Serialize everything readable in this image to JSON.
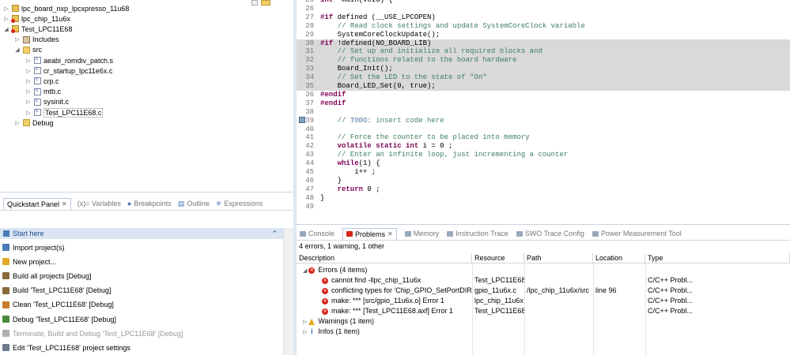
{
  "project_tree": {
    "items": [
      {
        "label": "lpc_board_nxp_lpcxpresso_11u68",
        "depth": 0,
        "twisty": "▷",
        "icon": "project-icon"
      },
      {
        "label": "lpc_chip_11u6x",
        "depth": 0,
        "twisty": "▷",
        "icon": "project-error-icon"
      },
      {
        "label": "Test_LPC11E68",
        "depth": 0,
        "twisty": "◢",
        "icon": "project-error-icon"
      },
      {
        "label": "Includes",
        "depth": 1,
        "twisty": "▷",
        "icon": "includes-icon"
      },
      {
        "label": "src",
        "depth": 1,
        "twisty": "◢",
        "icon": "folder-icon"
      },
      {
        "label": "aeabi_romdiv_patch.s",
        "depth": 2,
        "twisty": "▷",
        "icon": "file-icon"
      },
      {
        "label": "cr_startup_lpc11e6x.c",
        "depth": 2,
        "twisty": "▷",
        "icon": "file-icon"
      },
      {
        "label": "crp.c",
        "depth": 2,
        "twisty": "▷",
        "icon": "file-icon"
      },
      {
        "label": "mtb.c",
        "depth": 2,
        "twisty": "▷",
        "icon": "file-icon"
      },
      {
        "label": "sysinit.c",
        "depth": 2,
        "twisty": "▷",
        "icon": "file-icon"
      },
      {
        "label": "Test_LPC11E68.c",
        "depth": 2,
        "twisty": "▷",
        "icon": "file-icon"
      },
      {
        "label": "Debug",
        "depth": 1,
        "twisty": "▷",
        "icon": "folder-icon"
      }
    ]
  },
  "left_tabs": {
    "active": "Quickstart Panel",
    "others": [
      "(x)= Variables",
      "Breakpoints",
      "Outline",
      "Expressions"
    ]
  },
  "quickstart": {
    "header": "Start here",
    "items": [
      {
        "label": "Import project(s)",
        "color": "#4a7ab8",
        "enabled": true
      },
      {
        "label": "New project...",
        "color": "#e0a92a",
        "enabled": true
      },
      {
        "label": "Build all projects [Debug]",
        "color": "#8a6a3a",
        "enabled": true
      },
      {
        "label": "Build 'Test_LPC11E68' [Debug]",
        "color": "#8a6a3a",
        "enabled": true
      },
      {
        "label": "Clean 'Test_LPC11E68' [Debug]",
        "color": "#c97a2a",
        "enabled": true
      },
      {
        "label": "Debug 'Test_LPC11E68' [Debug]",
        "color": "#4a8a3a",
        "enabled": true
      },
      {
        "label": "Terminate, Build and Debug 'Test_LPC11E68' [Debug]",
        "color": "#b0b0b0",
        "enabled": false
      },
      {
        "label": "Edit 'Test_LPC11E68' project settings",
        "color": "#6a7a8a",
        "enabled": true
      }
    ]
  },
  "editor": {
    "lines": [
      {
        "n": "25",
        "html_parts": [
          [
            "kw",
            "int"
          ],
          [
            "",
            "  main(void) {"
          ]
        ],
        "hl": false
      },
      {
        "n": "26",
        "html_parts": [
          [
            "",
            ""
          ]
        ],
        "hl": false
      },
      {
        "n": "27",
        "html_parts": [
          [
            "pp",
            "#if"
          ],
          [
            "",
            " defined (__USE_LPCOPEN)"
          ]
        ],
        "hl": false
      },
      {
        "n": "28",
        "html_parts": [
          [
            "",
            "    "
          ],
          [
            "cm",
            "// Read clock settings and update SystemCoreClock variable"
          ]
        ],
        "hl": false
      },
      {
        "n": "29",
        "html_parts": [
          [
            "",
            "    SystemCoreClockUpdate();"
          ]
        ],
        "hl": false
      },
      {
        "n": "30",
        "html_parts": [
          [
            "pp",
            "#if"
          ],
          [
            "",
            " !defined(NO_BOARD_LIB)"
          ]
        ],
        "hl": true
      },
      {
        "n": "31",
        "html_parts": [
          [
            "",
            "    "
          ],
          [
            "cm",
            "// Set up and initialize all required blocks and"
          ]
        ],
        "hl": true
      },
      {
        "n": "32",
        "html_parts": [
          [
            "",
            "    "
          ],
          [
            "cm",
            "// functions related to the board hardware"
          ]
        ],
        "hl": true
      },
      {
        "n": "33",
        "html_parts": [
          [
            "",
            "    Board_Init();"
          ]
        ],
        "hl": true
      },
      {
        "n": "34",
        "html_parts": [
          [
            "",
            "    "
          ],
          [
            "cm",
            "// Set the LED to the state of \"On\""
          ]
        ],
        "hl": true
      },
      {
        "n": "35",
        "html_parts": [
          [
            "",
            "    Board_LED_Set(0, true);"
          ]
        ],
        "hl": true
      },
      {
        "n": "36",
        "html_parts": [
          [
            "pp",
            "#endif"
          ]
        ],
        "hl": false
      },
      {
        "n": "37",
        "html_parts": [
          [
            "pp",
            "#endif"
          ]
        ],
        "hl": false
      },
      {
        "n": "38",
        "html_parts": [
          [
            "",
            ""
          ]
        ],
        "hl": false
      },
      {
        "n": "39",
        "html_parts": [
          [
            "",
            "    "
          ],
          [
            "cm",
            "// "
          ],
          [
            "todo",
            "TODO"
          ],
          [
            "cm",
            ": insert code here"
          ]
        ],
        "hl": false
      },
      {
        "n": "40",
        "html_parts": [
          [
            "",
            ""
          ]
        ],
        "hl": false
      },
      {
        "n": "41",
        "html_parts": [
          [
            "",
            "    "
          ],
          [
            "cm",
            "// Force the counter to be placed into memory"
          ]
        ],
        "hl": false
      },
      {
        "n": "42",
        "html_parts": [
          [
            "",
            "    "
          ],
          [
            "kw",
            "volatile static int"
          ],
          [
            "",
            " i = 0 ;"
          ]
        ],
        "hl": false
      },
      {
        "n": "43",
        "html_parts": [
          [
            "",
            "    "
          ],
          [
            "cm",
            "// Enter an infinite loop, just incrementing a counter"
          ]
        ],
        "hl": false
      },
      {
        "n": "44",
        "html_parts": [
          [
            "",
            "    "
          ],
          [
            "kw",
            "while"
          ],
          [
            "",
            "(1) {"
          ]
        ],
        "hl": false
      },
      {
        "n": "45",
        "html_parts": [
          [
            "",
            "        i++ ;"
          ]
        ],
        "hl": false
      },
      {
        "n": "46",
        "html_parts": [
          [
            "",
            "    }"
          ]
        ],
        "hl": false
      },
      {
        "n": "47",
        "html_parts": [
          [
            "",
            "    "
          ],
          [
            "kw",
            "return"
          ],
          [
            "",
            " 0 ;"
          ]
        ],
        "hl": false
      },
      {
        "n": "48",
        "html_parts": [
          [
            "",
            "}"
          ]
        ],
        "hl": false
      },
      {
        "n": "49",
        "html_parts": [
          [
            "",
            ""
          ]
        ],
        "hl": false
      }
    ]
  },
  "bottom_tabs": {
    "items": [
      "Console",
      "Problems",
      "Memory",
      "Instruction Trace",
      "SWO Trace Config",
      "Power Measurement Tool"
    ],
    "active": "Problems"
  },
  "problems": {
    "summary": "4 errors, 1 warning, 1 other",
    "columns": [
      "Description",
      "Resource",
      "Path",
      "Location",
      "Type"
    ],
    "groups": [
      {
        "label": "Errors (4 items)",
        "kind": "error",
        "expanded": true
      },
      {
        "label": "Warnings (1 item)",
        "kind": "warning",
        "expanded": false
      },
      {
        "label": "Infos (1 item)",
        "kind": "info",
        "expanded": false
      }
    ],
    "rows": [
      {
        "description": "cannot find -llpc_chip_11u6x",
        "resource": "Test_LPC11E68",
        "path": "",
        "location": "",
        "type": "C/C++ Probl..."
      },
      {
        "description": "conflicting types for 'Chip_GPIO_SetPortDIR'",
        "resource": "gpio_11u6x.c",
        "path": "/lpc_chip_11u6x/src",
        "location": "line 96",
        "type": "C/C++ Probl..."
      },
      {
        "description": "make: *** [src/gpio_11u6x.o] Error 1",
        "resource": "lpc_chip_11u6x",
        "path": "",
        "location": "",
        "type": "C/C++ Probl..."
      },
      {
        "description": "make: *** [Test_LPC11E68.axf] Error 1",
        "resource": "Test_LPC11E68",
        "path": "",
        "location": "",
        "type": "C/C++ Probl..."
      }
    ]
  },
  "colors": {
    "accent": "#1d4a8c",
    "error": "#d9241c",
    "warning": "#e6a817",
    "highlight": "#d9d9d9"
  }
}
